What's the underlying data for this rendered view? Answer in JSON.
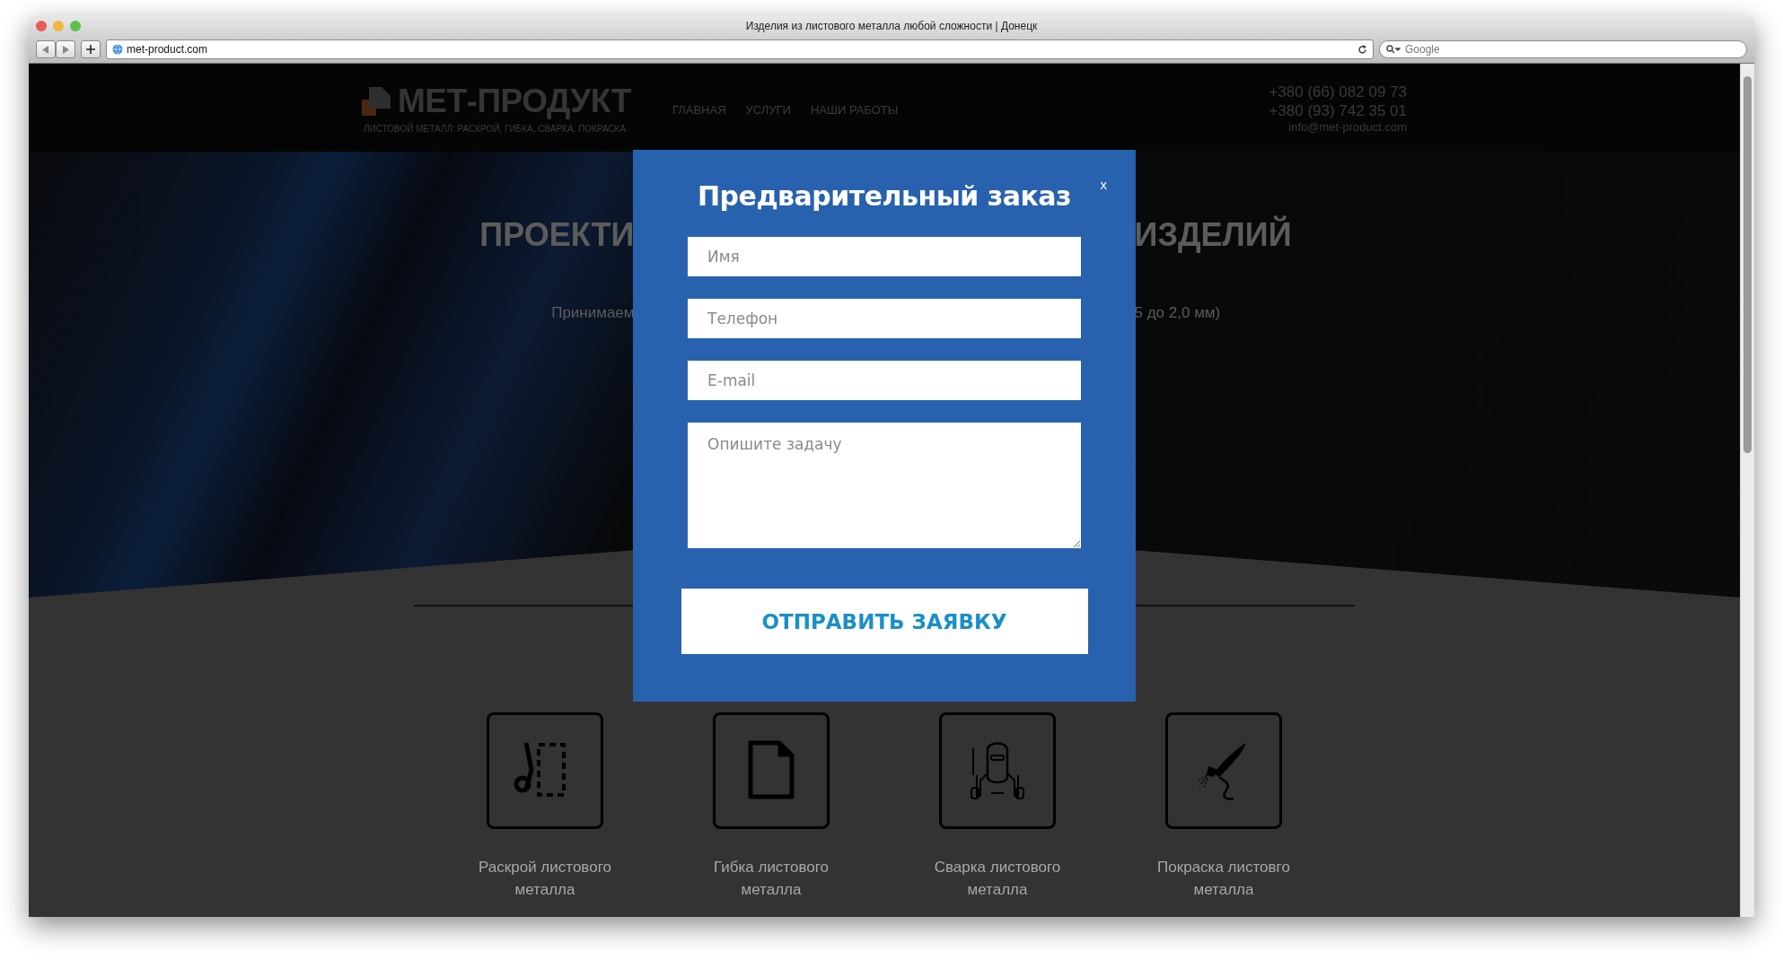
{
  "browser": {
    "title": "Изделия из листового металла любой сложности | Донецк",
    "url": "met-product.com",
    "search": {
      "placeholder": "Google"
    }
  },
  "header": {
    "logo": "МЕТ-ПРОДУКТ",
    "tagline": "ЛИСТОВОЙ МЕТАЛЛ: РАСКРОЙ, ГИБКА, СВАРКА, ПОКРАСКА",
    "nav": [
      {
        "label": "ГЛАВНАЯ"
      },
      {
        "label": "УСЛУГИ"
      },
      {
        "label": "НАШИ РАБОТЫ"
      }
    ],
    "phones": [
      "+380 (66) 082 09 73",
      "+380 (93) 742 35 01"
    ],
    "email": "info@met-product.com"
  },
  "hero": {
    "title_left": "ПРОЕКТИ",
    "title_right": "ИЗДЕЛИЙ",
    "subtitle_left": "Принимаем",
    "subtitle_right": "5 до 2,0 мм)"
  },
  "services": [
    {
      "kind": "cutting",
      "label": "Раскрой листового металла"
    },
    {
      "kind": "bending",
      "label": "Гибка листового металла"
    },
    {
      "kind": "welding",
      "label": "Сварка листового металла"
    },
    {
      "kind": "painting",
      "label": "Покраска листовго металла"
    }
  ],
  "modal": {
    "title": "Предварительный заказ",
    "close": "x",
    "fields": [
      {
        "kind": "input",
        "placeholder": "Имя"
      },
      {
        "kind": "input",
        "placeholder": "Телефон"
      },
      {
        "kind": "input",
        "placeholder": "E-mail"
      },
      {
        "kind": "textarea",
        "placeholder": "Опишите задачу"
      }
    ],
    "submit": "ОТПРАВИТЬ ЗАЯВКУ"
  }
}
